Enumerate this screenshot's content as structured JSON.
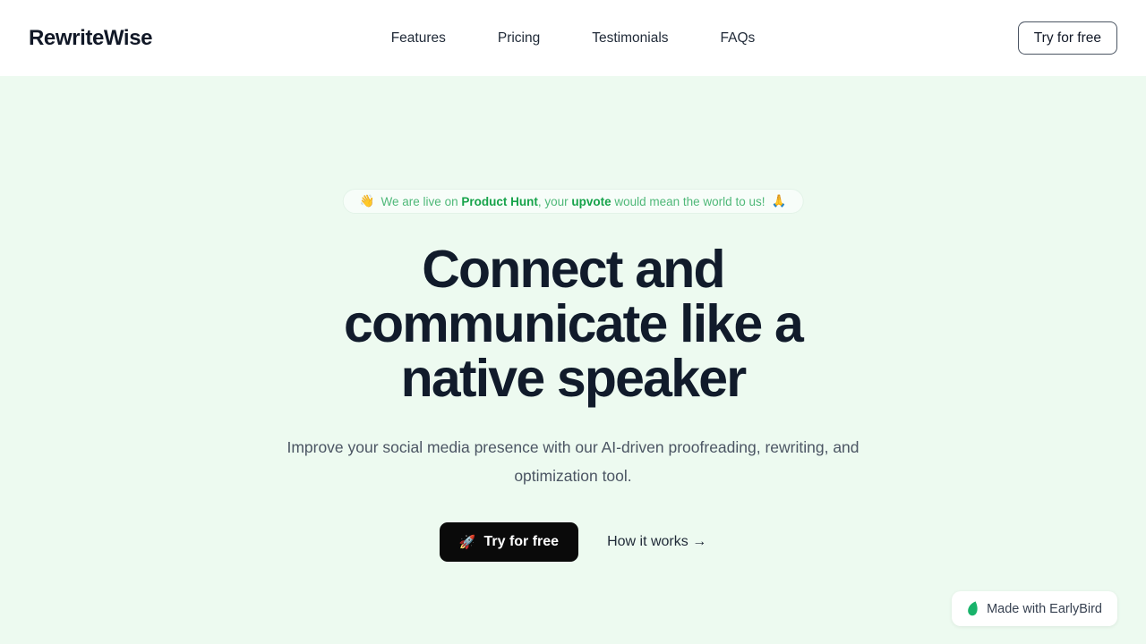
{
  "header": {
    "logo": "RewriteWise",
    "nav": [
      {
        "label": "Features"
      },
      {
        "label": "Pricing"
      },
      {
        "label": "Testimonials"
      },
      {
        "label": "FAQs"
      }
    ],
    "cta_label": "Try for free"
  },
  "hero": {
    "banner": {
      "emoji_left": "👋",
      "text_1": "We are live on ",
      "strong_1": "Product Hunt",
      "text_2": ", your ",
      "strong_2": "upvote",
      "text_3": " would mean the world to us! ",
      "emoji_right": "🙏"
    },
    "headline": "Connect and communicate like a native speaker",
    "subheadline": "Improve your social media presence with our AI-driven proofreading, rewriting, and optimization tool.",
    "primary_cta": {
      "emoji": "🚀",
      "label": "Try for free"
    },
    "secondary_cta": "How it works →"
  },
  "badge": {
    "icon": "bird-icon",
    "label": "Made with EarlyBird"
  },
  "colors": {
    "header_bg": "#ffffff",
    "hero_bg": "#edfaf0",
    "headline": "#111b2b",
    "green_regular": "#4eb878",
    "green_bold": "#16a34a",
    "button_black": "#0a0a0a",
    "bird_green": "#19b36b"
  }
}
